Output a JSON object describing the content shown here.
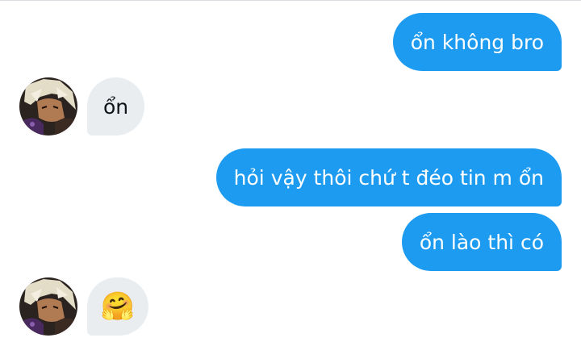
{
  "conversation": {
    "messages": [
      {
        "direction": "outgoing",
        "text": "ổn không bro"
      },
      {
        "direction": "incoming",
        "text": "ổn",
        "avatar": "anime-character-avatar"
      },
      {
        "direction": "outgoing",
        "text": "hỏi vậy thôi chứ t đéo tin m ổn"
      },
      {
        "direction": "outgoing",
        "text": "ổn lào thì có"
      },
      {
        "direction": "incoming",
        "text": "🤗",
        "avatar": "anime-character-avatar"
      }
    ]
  },
  "colors": {
    "outgoing_bubble": "#1d9bf0",
    "incoming_bubble": "#e9edf0",
    "outgoing_text": "#ffffff",
    "incoming_text": "#0f1419"
  }
}
